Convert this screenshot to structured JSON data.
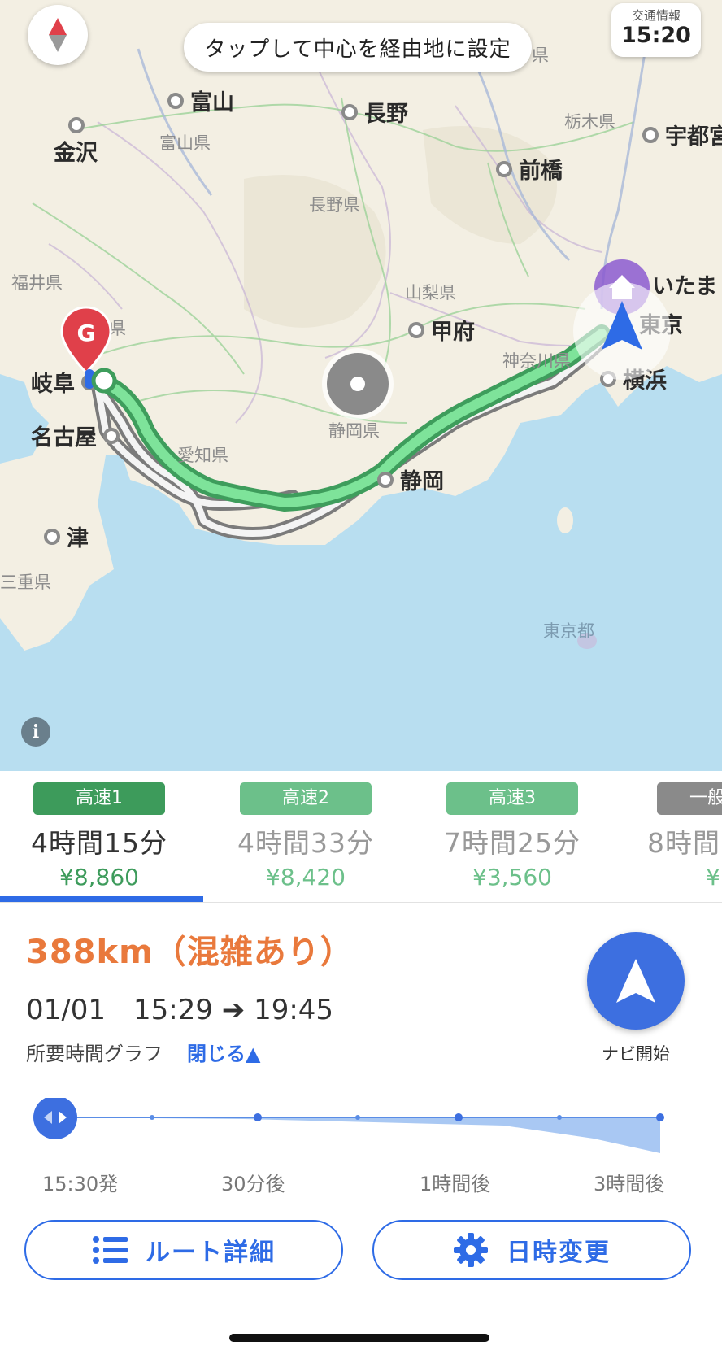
{
  "map": {
    "tap_hint": "タップして中心を経由地に設定",
    "traffic": {
      "label": "交通情報",
      "time": "15:20"
    },
    "cities": [
      {
        "name": "富山"
      },
      {
        "name": "長野"
      },
      {
        "name": "金沢"
      },
      {
        "name": "宇都宮"
      },
      {
        "name": "前橋"
      },
      {
        "name": "甲府"
      },
      {
        "name": "いたま"
      },
      {
        "name": "東京"
      },
      {
        "name": "岐阜"
      },
      {
        "name": "横浜"
      },
      {
        "name": "名古屋"
      },
      {
        "name": "静岡"
      },
      {
        "name": "津"
      }
    ],
    "prefectures": [
      {
        "name": "富山県"
      },
      {
        "name": "栃木県"
      },
      {
        "name": "長野県"
      },
      {
        "name": "福井県"
      },
      {
        "name": "山梨県"
      },
      {
        "name": "神奈川県"
      },
      {
        "name": "静岡県"
      },
      {
        "name": "愛知県"
      },
      {
        "name": "三重県"
      },
      {
        "name": "東京都"
      },
      {
        "name": "県"
      },
      {
        "name": "県"
      }
    ],
    "goal_marker": "G",
    "info_icon": "i"
  },
  "routes": [
    {
      "badge": "高速1",
      "duration": "4時間15分",
      "fare": "¥8,860",
      "color": "#3d9b5b",
      "selected": true
    },
    {
      "badge": "高速2",
      "duration": "4時間33分",
      "fare": "¥8,420",
      "color": "#6cc08a",
      "selected": false
    },
    {
      "badge": "高速3",
      "duration": "7時間25分",
      "fare": "¥3,560",
      "color": "#6cc08a",
      "selected": false
    },
    {
      "badge": "一般",
      "duration": "8時間",
      "fare": "¥",
      "color": "#8a8a8a",
      "selected": false
    }
  ],
  "detail": {
    "distance": "388km（混雑あり）",
    "time_range": "01/01　15:29 ➔ 19:45",
    "graph_label": "所要時間グラフ",
    "graph_close": "閉じる▲",
    "navi_label": "ナビ開始"
  },
  "time_graph": {
    "labels": [
      "15:30発",
      "30分後",
      "1時間後",
      "3時間後"
    ]
  },
  "buttons": {
    "route_detail": "ルート詳細",
    "change_datetime": "日時変更"
  },
  "colors": {
    "accent": "#2e6be6",
    "route_main": "#5ccf7d",
    "distance": "#e9793c"
  }
}
